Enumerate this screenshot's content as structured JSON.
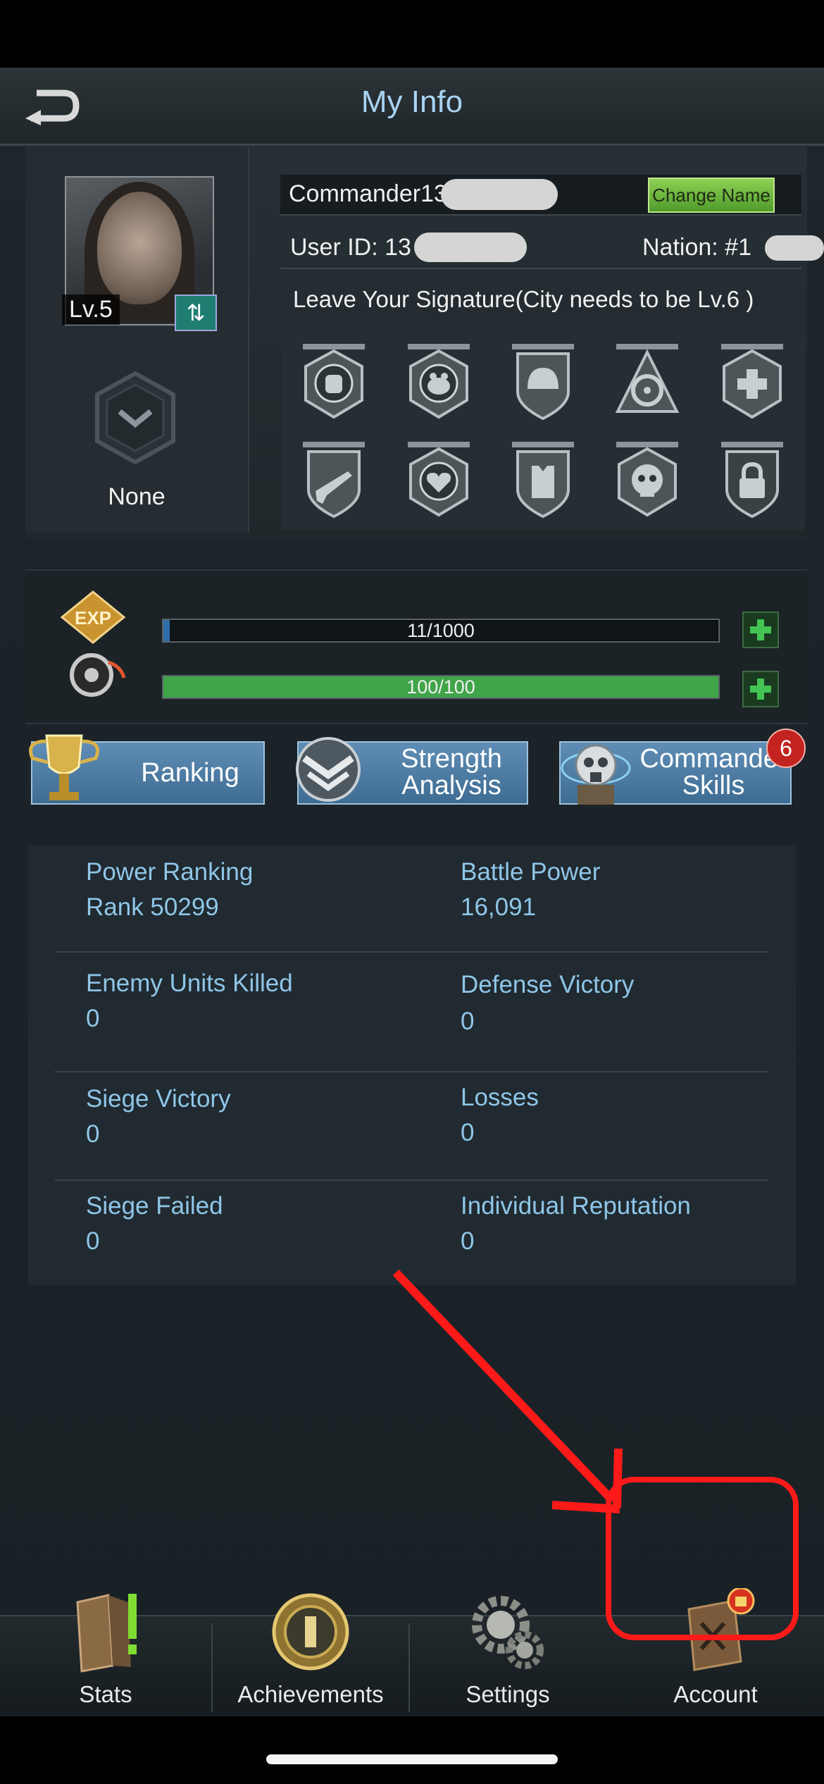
{
  "header": {
    "title": "My Info"
  },
  "profile": {
    "level": "Lv.5",
    "rank_title": "None",
    "name": "Commander13",
    "change_name_label": "Change Name",
    "user_id": "User ID: 13",
    "nation": "Nation: #1",
    "signature": "Leave Your Signature(City needs to be Lv.6 )",
    "badges": [
      "fist-badge-icon",
      "toad-badge-icon",
      "helmet-badge-icon",
      "biohazard-badge-icon",
      "medic-cross-badge-icon",
      "rifle-badge-icon",
      "heart-badge-icon",
      "armor-vest-badge-icon",
      "skull-badge-icon",
      "padlock-badge-icon"
    ]
  },
  "bars": {
    "exp": {
      "text": "11/1000",
      "fraction": 0.011,
      "color": "#2f6fa8"
    },
    "stamina": {
      "text": "100/100",
      "fraction": 1.0,
      "color": "#3fa548"
    }
  },
  "actions": {
    "ranking": "Ranking",
    "strength_line1": "Strength",
    "strength_line2": "Analysis",
    "commander_line1": "Commander",
    "commander_line2": "Skills",
    "commander_badge": "6"
  },
  "stats": [
    {
      "left_label": "Power Ranking",
      "left_value": "Rank 50299",
      "right_label": "Battle Power",
      "right_value": "16,091"
    },
    {
      "left_label": "Enemy Units Killed",
      "left_value": "0",
      "right_label": "Defense Victory",
      "right_value": "0"
    },
    {
      "left_label": "Siege Victory",
      "left_value": "0",
      "right_label": "Losses",
      "right_value": "0"
    },
    {
      "left_label": "Siege Failed",
      "left_value": "0",
      "right_label": "Individual Reputation",
      "right_value": "0"
    }
  ],
  "nav": {
    "stats": "Stats",
    "achievements": "Achievements",
    "settings": "Settings",
    "account": "Account"
  },
  "colors": {
    "accent_blue": "#a9d3f2",
    "stat_text": "#8fc6e8",
    "annotation_red": "#ff1a1a"
  }
}
